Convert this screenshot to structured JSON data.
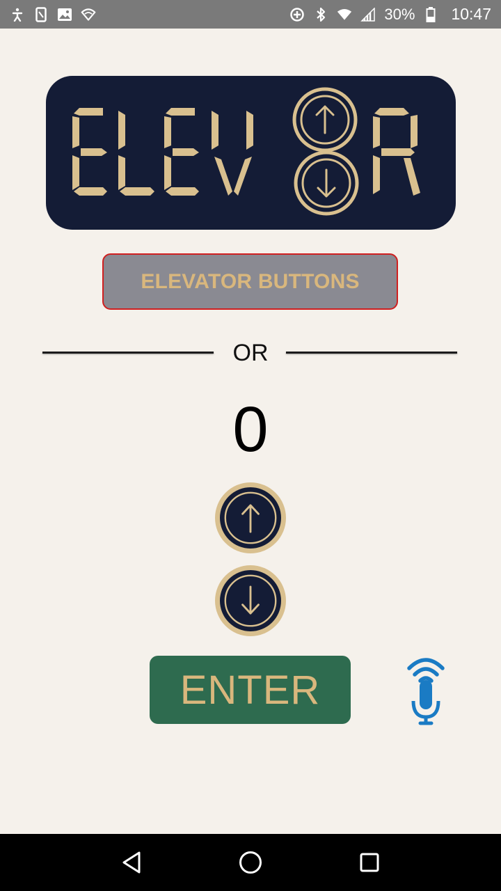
{
  "status_bar": {
    "battery": "30%",
    "time": "10:47",
    "icons_left": [
      "accessibility-icon",
      "phone-frame-icon",
      "image-icon",
      "wifi-shield-icon"
    ],
    "icons_right": [
      "data-saver-icon",
      "bluetooth-icon",
      "wifi-icon",
      "signal-icon",
      "battery-icon"
    ]
  },
  "logo": {
    "text_left": "ELEV",
    "text_right": "R",
    "colors": {
      "background": "#141c36",
      "accent": "#d9c08f"
    }
  },
  "mode_button": {
    "label": "ELEVATOR BUTTONS"
  },
  "divider": {
    "label": "OR"
  },
  "floor": {
    "value": "0"
  },
  "controls": {
    "up_icon": "arrow-up-icon",
    "down_icon": "arrow-down-icon"
  },
  "enter_button": {
    "label": "ENTER"
  },
  "mic": {
    "icon": "voice-input-icon",
    "color": "#1a7bc4"
  },
  "nav_bar": {
    "items": [
      "back-icon",
      "home-icon",
      "recents-icon"
    ]
  },
  "colors": {
    "background": "#f5f1eb",
    "navy": "#141c36",
    "gold": "#d9c08f",
    "green": "#2e6b4f",
    "gray_button": "#8a8a92",
    "red_border": "#d01f1f"
  }
}
